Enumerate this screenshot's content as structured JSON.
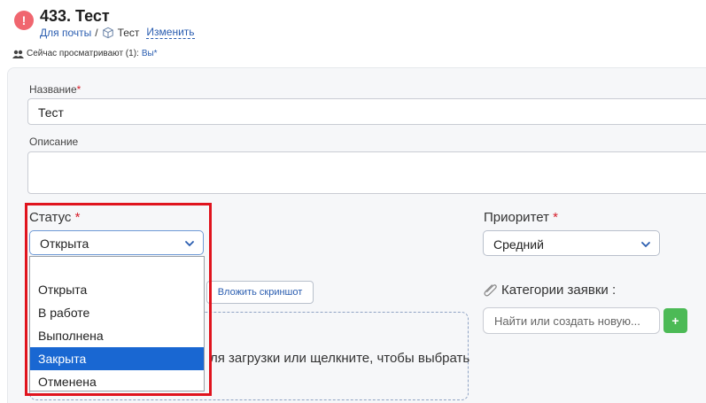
{
  "ticket": {
    "title": "433. Тест",
    "alert_glyph": "!",
    "breadcrumb_link": "Для почты",
    "breadcrumb_sep": "/",
    "breadcrumb_item": "Тест",
    "change_link": "Изменить"
  },
  "viewers": {
    "prefix": "Сейчас просматривают (1):",
    "you": "Вы*"
  },
  "form": {
    "name_label": "Название",
    "name_value": "Тест",
    "desc_label": "Описание",
    "desc_value": "",
    "required_mark": "*",
    "status_label": "Статус",
    "status_value": "Открыта",
    "status_options": [
      "",
      "Открыта",
      "В работе",
      "Выполнена",
      "Закрыта",
      "Отменена"
    ],
    "status_highlighted": "Закрыта",
    "priority_label": "Приоритет",
    "priority_value": "Средний",
    "screenshot_button": "Вложить скриншот",
    "dropzone_text": "ля загрузки или щелкните, чтобы выбрать",
    "categories_label": "Категории заявки :",
    "categories_placeholder": "Найти или создать новую...",
    "add_button": "+"
  },
  "colors": {
    "accent": "#2a5db0",
    "alert": "#f0666f",
    "selected_option": "#1967d2",
    "highlight_box": "#e0141e",
    "add_button": "#4cba56"
  }
}
